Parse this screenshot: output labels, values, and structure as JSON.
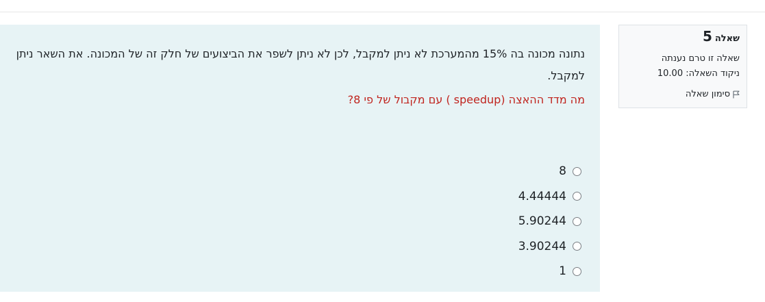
{
  "question_info": {
    "label": "שאלה",
    "number": "5",
    "status": "שאלה זו טרם נענתה",
    "grade_label": "ניקוד השאלה:",
    "grade_value": "10.00",
    "flag_label": "סימון שאלה",
    "flag_icon": "flag-outline-icon"
  },
  "question": {
    "text": "נתונה מכונה בה 15% מהמערכת לא ניתן למקבל, לכן לא ניתן לשפר את הביצועים של חלק זה של המכונה. את השאר ניתן למקבל.",
    "prompt": "מה מדד ההאצה (speedup ) עם מקבול של פי 8?",
    "prompt_color": "#c0241e"
  },
  "answers": [
    {
      "label": "8",
      "selected": false
    },
    {
      "label": "4.44444",
      "selected": false
    },
    {
      "label": "5.90244",
      "selected": false
    },
    {
      "label": "3.90244",
      "selected": false
    },
    {
      "label": "1",
      "selected": false
    }
  ],
  "colors": {
    "content_bg": "#e7f3f5",
    "info_bg": "#f8f9fa",
    "info_border": "#dee2e6",
    "text": "#1d2125"
  }
}
